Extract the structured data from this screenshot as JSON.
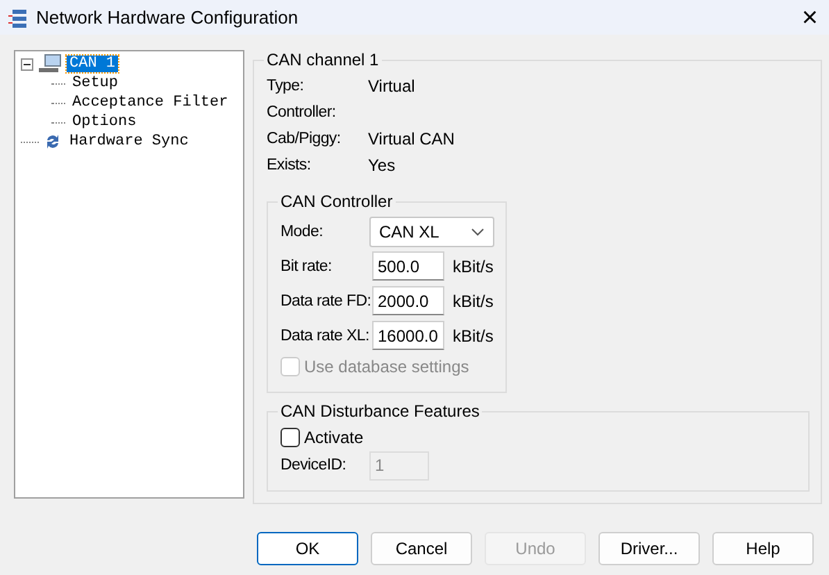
{
  "window": {
    "title": "Network Hardware Configuration",
    "close": "×"
  },
  "tree": [
    {
      "label": "CAN 1",
      "kind": "computer",
      "expanded": true,
      "selected": true,
      "children": [
        {
          "label": "Setup",
          "selected": false
        },
        {
          "label": "Acceptance Filter",
          "selected": false
        },
        {
          "label": "Options",
          "selected": false
        }
      ]
    },
    {
      "label": "Hardware Sync",
      "kind": "sync",
      "selected": false
    }
  ],
  "channel": {
    "title": "CAN channel 1",
    "info": [
      {
        "label": "Type:",
        "value": "Virtual"
      },
      {
        "label": "Controller:"
      },
      {
        "label": "Cab/Piggy:",
        "value": "Virtual CAN"
      },
      {
        "label": "Exists:",
        "value": "Yes"
      }
    ]
  },
  "controller": {
    "title": "CAN Controller",
    "mode": {
      "label": "Mode:",
      "value": "CAN XL"
    },
    "rates": [
      {
        "label": "Bit rate:",
        "value": "500.0",
        "unit": "kBit/s"
      },
      {
        "label": "Data rate FD:",
        "value": "2000.0",
        "unit": "kBit/s"
      },
      {
        "label": "Data rate XL:",
        "value": "16000.0",
        "unit": "kBit/s"
      }
    ],
    "use_db": {
      "label": "Use database settings",
      "checked": false,
      "disabled": true
    }
  },
  "disturbance": {
    "title": "CAN Disturbance Features",
    "activate": {
      "label": "Activate",
      "checked": false,
      "disabled": false
    },
    "device_id": {
      "label": "DeviceID:",
      "value": "1",
      "disabled": true
    }
  },
  "buttons": [
    {
      "label": "OK",
      "focused": true,
      "disabled": false
    },
    {
      "label": "Cancel",
      "focused": false,
      "disabled": false
    },
    {
      "label": "Undo",
      "focused": false,
      "disabled": true
    },
    {
      "label": "Driver...",
      "focused": false,
      "disabled": false
    },
    {
      "label": "Help",
      "focused": false,
      "disabled": false
    }
  ]
}
